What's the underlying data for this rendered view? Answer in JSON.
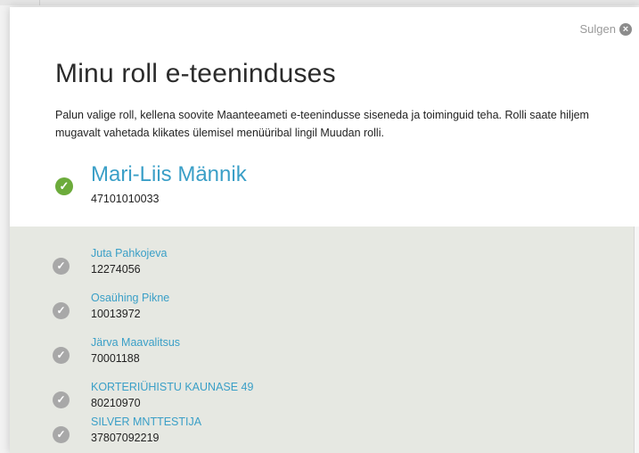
{
  "dialog": {
    "close_label": "Sulgen",
    "title": "Minu roll e-teeninduses",
    "intro": "Palun valige roll, kellena soovite Maanteeameti e-teenindusse siseneda ja toiminguid teha. Rolli saate hiljem mugavalt vahetada klikates ülemisel menüüribal lingil Muudan rolli."
  },
  "current_role": {
    "name": "Mari-Liis Männik",
    "code": "47101010033"
  },
  "roles": [
    {
      "name": "Juta Pahkojeva",
      "code": "12274056"
    },
    {
      "name": "Osaühing Pikne",
      "code": "10013972"
    },
    {
      "name": "Järva Maavalitsus",
      "code": "70001188"
    },
    {
      "name": "KORTERIÜHISTU KAUNASE 49",
      "code": "80210970"
    },
    {
      "name": "SILVER MNTTESTIJA",
      "code": "37807092219"
    }
  ],
  "colors": {
    "accent": "#3a9fc7",
    "selected_check": "#6cab3b",
    "unselected_check": "#a8a8a8",
    "list_background": "#e6e8e2"
  }
}
